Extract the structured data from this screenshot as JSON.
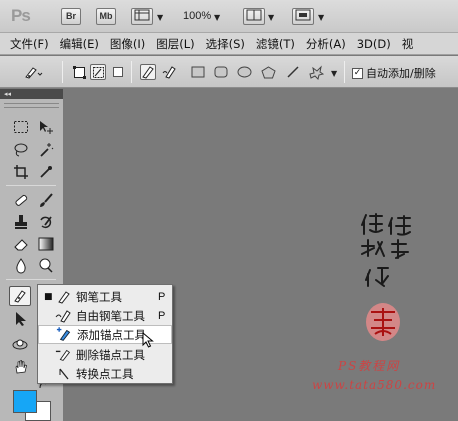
{
  "app": {
    "logo": "Ps",
    "bridge_label": "Br",
    "minibridge_label": "Mb",
    "zoom": "100%"
  },
  "menubar": {
    "items": [
      "文件(F)",
      "编辑(E)",
      "图像(I)",
      "图层(L)",
      "选择(S)",
      "滤镜(T)",
      "分析(A)",
      "3D(D)",
      "视"
    ]
  },
  "options": {
    "auto_add_label": "自动添加/删除",
    "auto_add_checked": "✓"
  },
  "flyout": {
    "items": [
      {
        "bullet": "■",
        "label": "钢笔工具",
        "shortcut": "P"
      },
      {
        "bullet": "",
        "label": "自由钢笔工具",
        "shortcut": "P"
      },
      {
        "bullet": "",
        "label": "添加锚点工具",
        "shortcut": ""
      },
      {
        "bullet": "",
        "label": "删除锚点工具",
        "shortcut": ""
      },
      {
        "bullet": "",
        "label": "转换点工具",
        "shortcut": ""
      }
    ]
  },
  "colors": {
    "foreground": "#16a6f6",
    "background": "#ffffff",
    "canvas": "#7a7a7a"
  },
  "watermark": {
    "site_line1": "PS教程网",
    "site_line2": "www.tata580.com",
    "calligraphy": "他她我帮你"
  }
}
